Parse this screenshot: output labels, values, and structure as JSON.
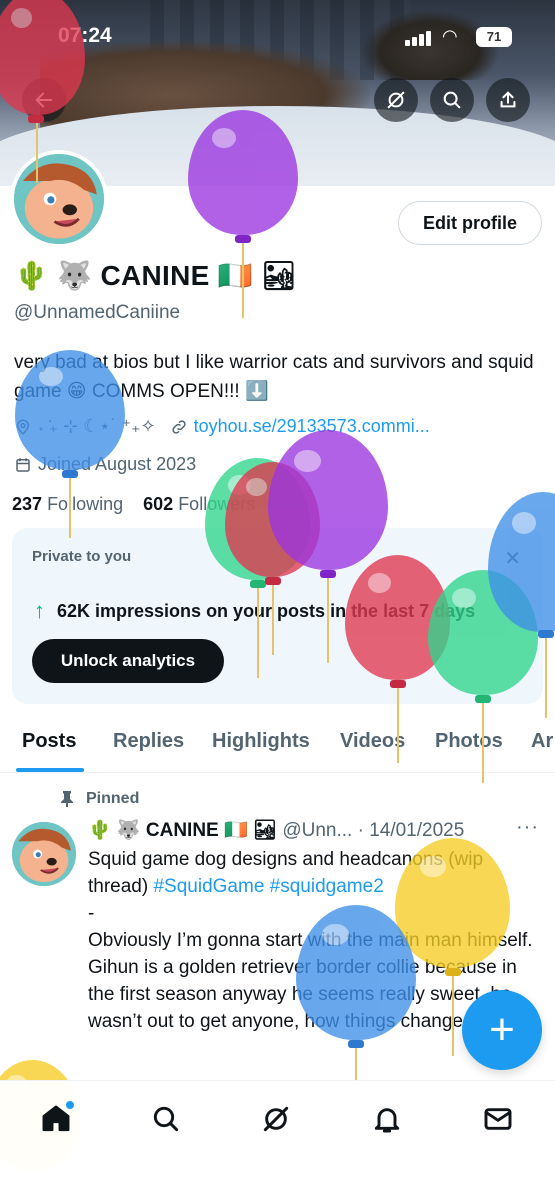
{
  "status_bar": {
    "time": "07:24",
    "battery": "71"
  },
  "profile": {
    "display_name": "🌵 🐺 CANINE 🇮🇪 🏜",
    "handle": "@UnnamedCaniine",
    "bio": "very bad at bios but I like warrior cats and survivors and squid game 😁 COMMS OPEN!!! ⬇️",
    "location": "˖ ݁₊ ⊹ ☾⋆˙ ⁺₊✧",
    "link": "toyhou.se/29133573.commi...",
    "joined": "Joined August 2023",
    "following_count": "237",
    "following_label": "Following",
    "followers_count": "602",
    "followers_label": "Followers",
    "edit_profile_label": "Edit profile"
  },
  "private_card": {
    "title": "Private to you",
    "impressions": "62K impressions on your posts in the last 7 days",
    "unlock_label": "Unlock analytics",
    "close_icon": "close-icon"
  },
  "tabs": [
    {
      "label": "Posts",
      "active": true
    },
    {
      "label": "Replies"
    },
    {
      "label": "Highlights"
    },
    {
      "label": "Videos"
    },
    {
      "label": "Photos"
    },
    {
      "label": "Ar"
    }
  ],
  "pinned_post": {
    "pinned_label": "Pinned",
    "name": "🌵 🐺 CANINE 🇮🇪 🏜",
    "handle_date": "@Unn... · 14/01/2025",
    "more": "···",
    "text_line1": "Squid game dog designs and headcanons (wip thread) ",
    "hashtag1": "#SquidGame",
    "hashtag2": "#squidgame2",
    "text_rest": "-\nObviously I’m gonna start with the main man himself. Gihun is a golden retriever border collie because in the first season anyway he seems really sweet, he wasn’t out to get anyone, how things change"
  },
  "fab": {
    "label": "+"
  },
  "nav": [
    "home-icon",
    "search-icon",
    "grok-icon",
    "notifications-icon",
    "messages-icon"
  ],
  "colors": {
    "accent": "#1d9bf0",
    "text": "#0f1419",
    "muted": "#536471",
    "success": "#00ba7c"
  }
}
